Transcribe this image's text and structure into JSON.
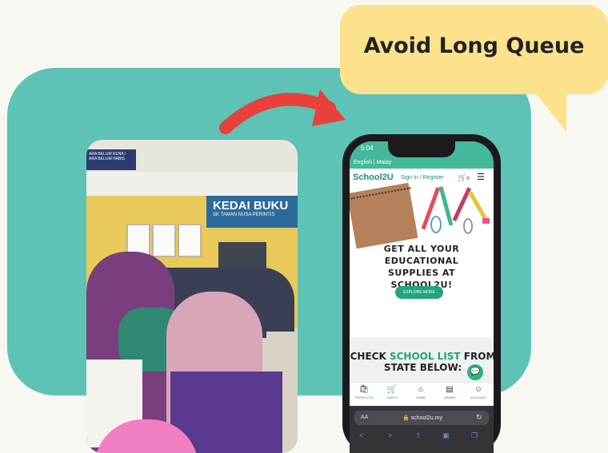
{
  "callout": {
    "text": "Avoid Long Queue"
  },
  "photo": {
    "shop_sign": "KEDAI BUKU",
    "shop_sign_sub": "SK TAMAN NUSA PERINTIS",
    "left_sign": "ARA BELUM KENA / ARA BELUM HABIS"
  },
  "phone": {
    "status_time": "5:04",
    "language_bar": "English  |  Malay",
    "logo": "School2U",
    "signin_link": "Sign In / Register",
    "cart_count": "0",
    "hero_title": "GET ALL YOUR\nEDUCATIONAL\nSUPPLIES AT\nSCHOOL2U!",
    "explore_button": "EXPLORE MORE",
    "check_prefix": "CHECK ",
    "check_highlight": "SCHOOL LIST",
    "check_suffix": " FROM",
    "check_line2": "STATE BELOW:",
    "bottom_nav": [
      {
        "label": "PRODUCTS",
        "icon": "bag-icon"
      },
      {
        "label": "CARTS",
        "icon": "cart-icon"
      },
      {
        "label": "HOME",
        "icon": "home-icon"
      },
      {
        "label": "ORDER",
        "icon": "receipt-icon"
      },
      {
        "label": "ACCOUNT",
        "icon": "user-icon"
      }
    ],
    "safari": {
      "aa": "AA",
      "url": "school2u.my"
    }
  },
  "colors": {
    "teal": "#5ec2b4",
    "callout": "#fce28d",
    "arrow": "#e8403a",
    "brand": "#1d8f73"
  }
}
